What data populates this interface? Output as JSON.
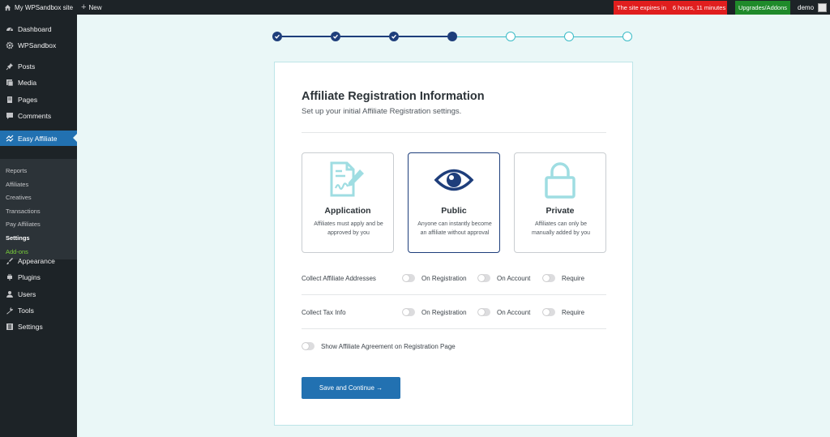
{
  "adminbar": {
    "site_name": "My WPSandbox site",
    "new_label": "New",
    "expire_text": "The site expires in",
    "expire_time": "6 hours, 11 minutes",
    "upgrade_label": "Upgrades/Addons",
    "user_name": "demo"
  },
  "sidebar": {
    "items": [
      {
        "label": "Dashboard",
        "icon": "dashboard-icon"
      },
      {
        "label": "WPSandbox",
        "icon": "gear-icon"
      },
      {
        "label": "Posts",
        "icon": "pin-icon"
      },
      {
        "label": "Media",
        "icon": "media-icon"
      },
      {
        "label": "Pages",
        "icon": "pages-icon"
      },
      {
        "label": "Comments",
        "icon": "comment-icon"
      },
      {
        "label": "Easy Affiliate",
        "icon": "affiliate-icon"
      },
      {
        "label": "Appearance",
        "icon": "brush-icon"
      },
      {
        "label": "Plugins",
        "icon": "plug-icon"
      },
      {
        "label": "Users",
        "icon": "users-icon"
      },
      {
        "label": "Tools",
        "icon": "wrench-icon"
      },
      {
        "label": "Settings",
        "icon": "settings-icon"
      }
    ],
    "submenu": [
      "Reports",
      "Affiliates",
      "Creatives",
      "Transactions",
      "Pay Affiliates",
      "Settings",
      "Add-ons"
    ]
  },
  "stepper": {
    "total_steps": 7,
    "completed_steps": 3,
    "current_step": 4
  },
  "card": {
    "title": "Affiliate Registration Information",
    "subtitle": "Set up your initial Affiliate Registration settings.",
    "options": [
      {
        "title": "Application",
        "desc": "Affiliates must apply and be approved by you",
        "icon": "application-form-icon"
      },
      {
        "title": "Public",
        "desc": "Anyone can instantly become an affiliate without approval",
        "icon": "eye-icon"
      },
      {
        "title": "Private",
        "desc": "Affiliates can only be manually added by you",
        "icon": "lock-icon"
      }
    ],
    "selected_option": "Public",
    "rows": [
      {
        "label": "Collect Affiliate Addresses",
        "toggles": [
          "On Registration",
          "On Account",
          "Require"
        ]
      },
      {
        "label": "Collect Tax Info",
        "toggles": [
          "On Registration",
          "On Account",
          "Require"
        ]
      }
    ],
    "agreement_label": "Show Affiliate Agreement on Registration Page",
    "save_label": "Save and Continue →"
  },
  "colors": {
    "accent": "#2271b1",
    "step_done": "#1e3e7b",
    "step_todo": "#3cbcc7",
    "icon_teal": "#9fdde2",
    "public_icon": "#1e3e7b",
    "expire_bg": "#e01e1e",
    "upgrade_bg": "#1f8a2a"
  }
}
